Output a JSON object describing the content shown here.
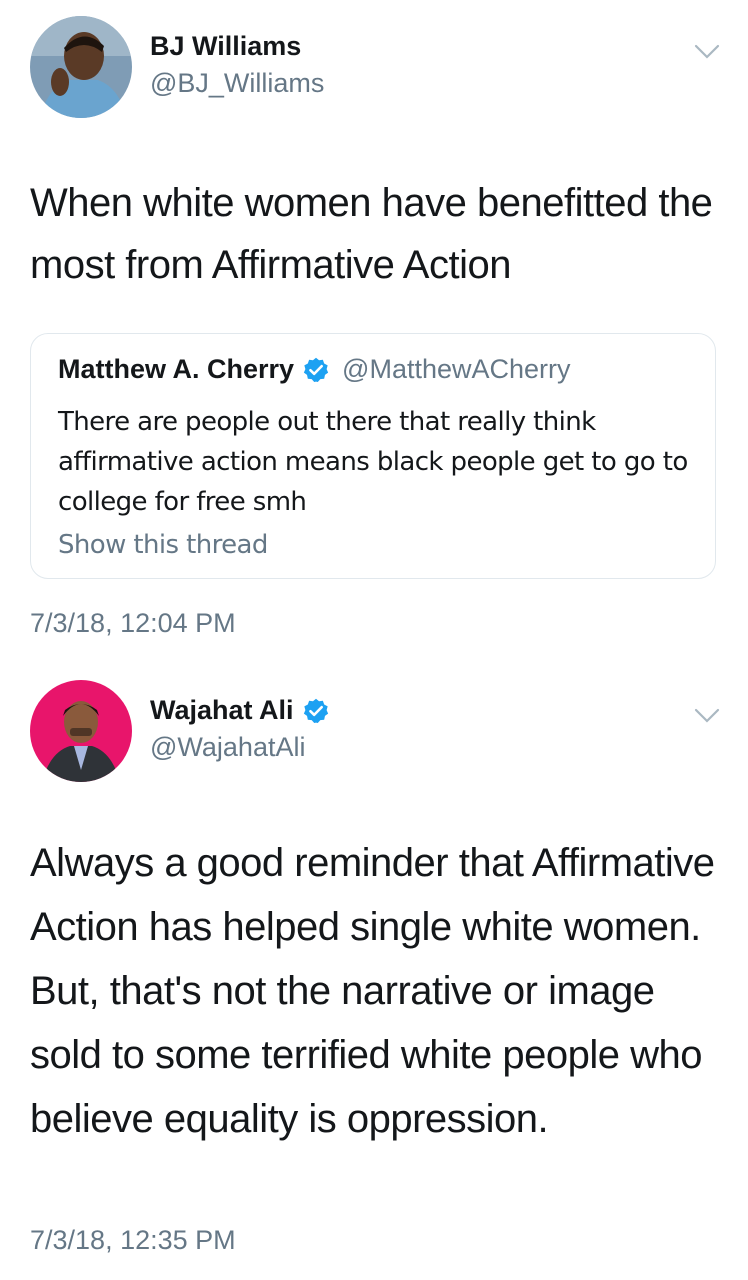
{
  "tweets": [
    {
      "name": "BJ Williams",
      "handle": "@BJ_Williams",
      "verified": false,
      "text": "When white women have benefitted the most from Affirmative Action",
      "quoted_tweet": {
        "name": "Matthew A. Cherry",
        "handle": "@MatthewACherry",
        "verified": true,
        "text": "There are people out there that really think affirmative action means black people get to go to college for free smh",
        "thread_link": "Show this thread"
      },
      "timestamp": "7/3/18, 12:04 PM",
      "menu_icon": "chevron-down-icon"
    },
    {
      "name": "Wajahat Ali",
      "handle": "@WajahatAli",
      "verified": true,
      "text": "Always a good reminder that Affirmative Action has helped single white women. But, that's not the narrative or image sold to some terrified white people who believe equality is oppression.",
      "timestamp": "7/3/18, 12:35 PM",
      "menu_icon": "chevron-down-icon"
    }
  ],
  "colors": {
    "text_primary": "#14171a",
    "text_secondary": "#657786",
    "verified_blue": "#1da1f2",
    "border": "#e1e8ed",
    "avatar2_background": "#e8156b"
  }
}
